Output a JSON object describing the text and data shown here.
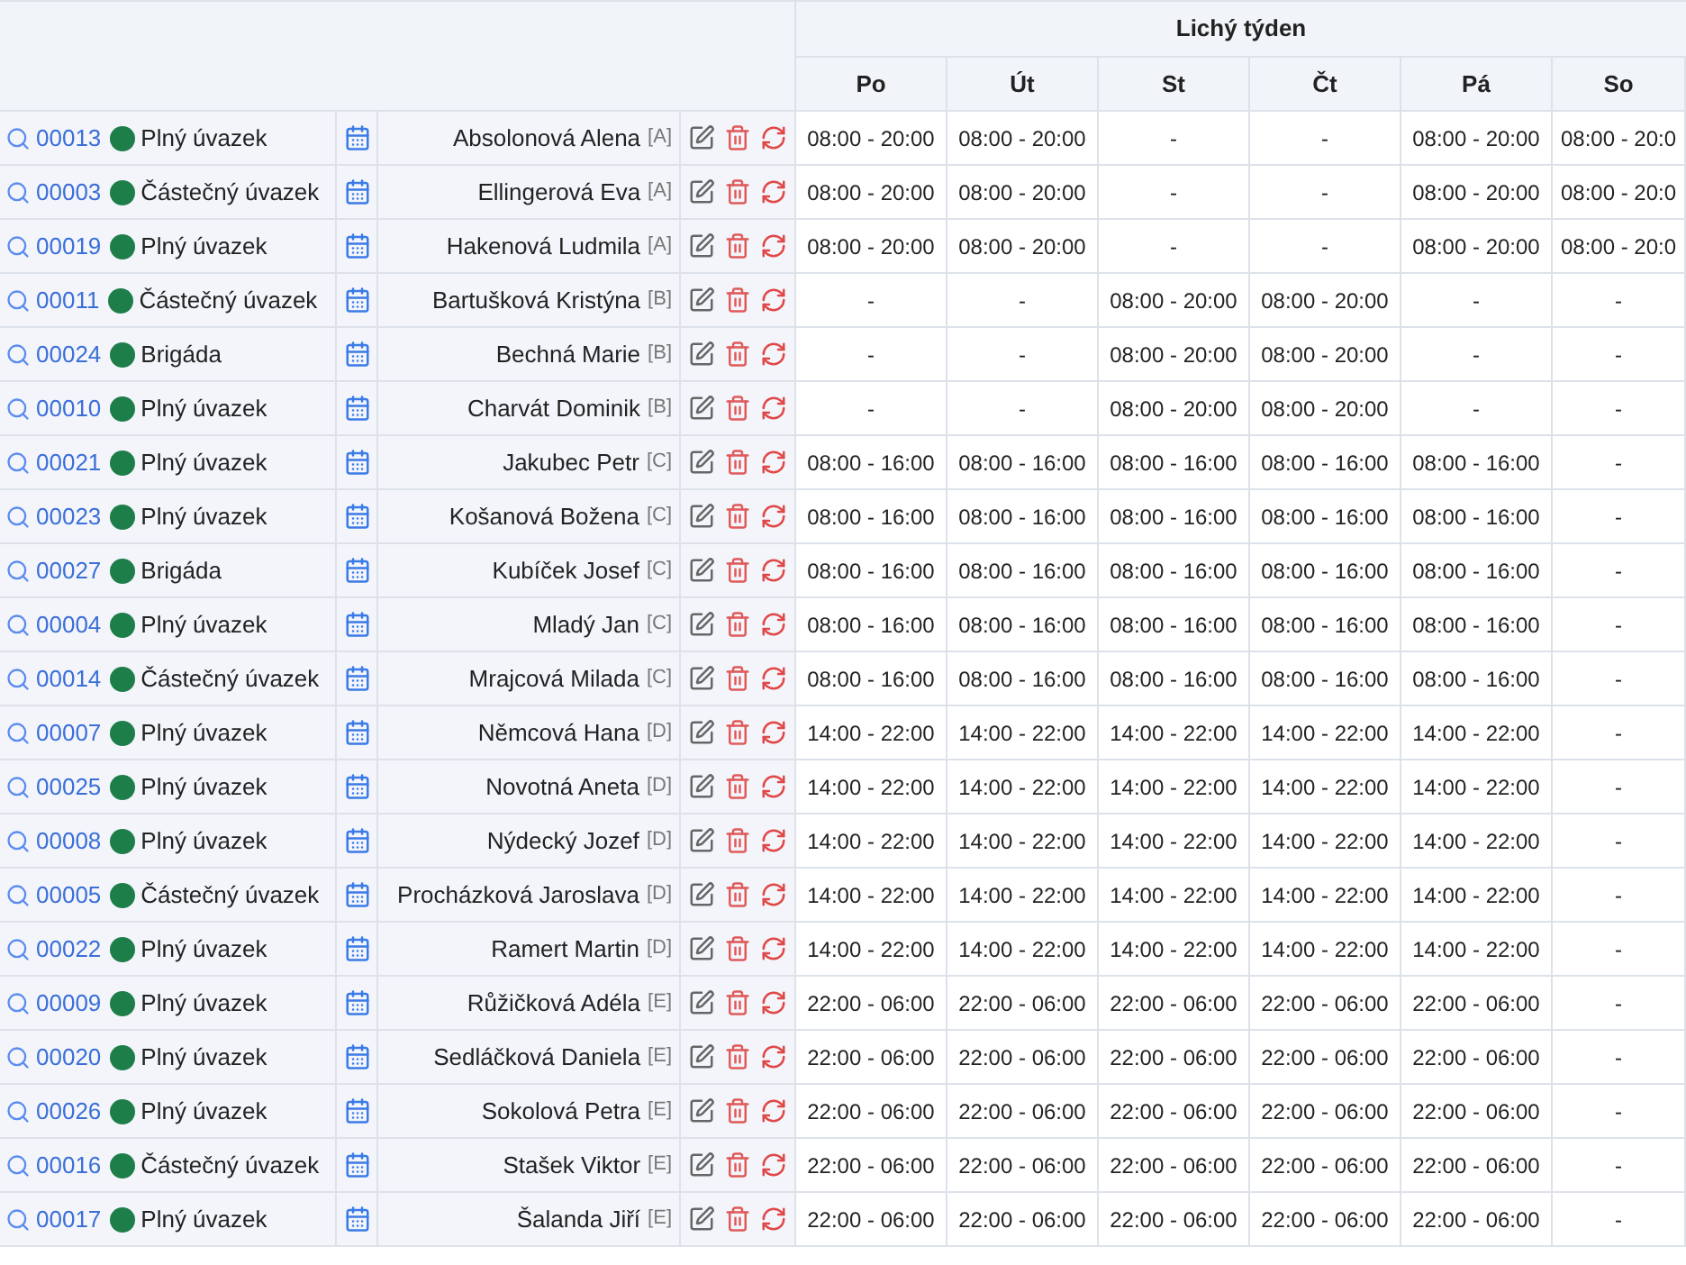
{
  "header": {
    "week_title": "Lichý týden",
    "days": [
      "Po",
      "Út",
      "St",
      "Čt",
      "Pá",
      "So"
    ]
  },
  "rows": [
    {
      "id": "00013",
      "color": "#1e7e4a",
      "type": "Plný úvazek",
      "name": "Absolonová Alena",
      "group": "[A]",
      "cells": [
        "08:00 - 20:00",
        "08:00 - 20:00",
        "-",
        "-",
        "08:00 - 20:00",
        "08:00 - 20:0"
      ]
    },
    {
      "id": "00003",
      "color": "#1e7e4a",
      "type": "Částečný úvazek",
      "name": "Ellingerová Eva",
      "group": "[A]",
      "cells": [
        "08:00 - 20:00",
        "08:00 - 20:00",
        "-",
        "-",
        "08:00 - 20:00",
        "08:00 - 20:0"
      ]
    },
    {
      "id": "00019",
      "color": "#1e7e4a",
      "type": "Plný úvazek",
      "name": "Hakenová Ludmila",
      "group": "[A]",
      "cells": [
        "08:00 - 20:00",
        "08:00 - 20:00",
        "-",
        "-",
        "08:00 - 20:00",
        "08:00 - 20:0"
      ]
    },
    {
      "id": "00011",
      "color": "#1e7e4a",
      "type": "Částečný úvazek",
      "name": "Bartušková Kristýna",
      "group": "[B]",
      "cells": [
        "-",
        "-",
        "08:00 - 20:00",
        "08:00 - 20:00",
        "-",
        "-"
      ]
    },
    {
      "id": "00024",
      "color": "#1e7e4a",
      "type": "Brigáda",
      "name": "Bechná Marie",
      "group": "[B]",
      "cells": [
        "-",
        "-",
        "08:00 - 20:00",
        "08:00 - 20:00",
        "-",
        "-"
      ]
    },
    {
      "id": "00010",
      "color": "#1e7e4a",
      "type": "Plný úvazek",
      "name": "Charvát Dominik",
      "group": "[B]",
      "cells": [
        "-",
        "-",
        "08:00 - 20:00",
        "08:00 - 20:00",
        "-",
        "-"
      ]
    },
    {
      "id": "00021",
      "color": "#1e7e4a",
      "type": "Plný úvazek",
      "name": "Jakubec Petr",
      "group": "[C]",
      "cells": [
        "08:00 - 16:00",
        "08:00 - 16:00",
        "08:00 - 16:00",
        "08:00 - 16:00",
        "08:00 - 16:00",
        "-"
      ]
    },
    {
      "id": "00023",
      "color": "#1e7e4a",
      "type": "Plný úvazek",
      "name": "Košanová Božena",
      "group": "[C]",
      "cells": [
        "08:00 - 16:00",
        "08:00 - 16:00",
        "08:00 - 16:00",
        "08:00 - 16:00",
        "08:00 - 16:00",
        "-"
      ]
    },
    {
      "id": "00027",
      "color": "#1e7e4a",
      "type": "Brigáda",
      "name": "Kubíček Josef",
      "group": "[C]",
      "cells": [
        "08:00 - 16:00",
        "08:00 - 16:00",
        "08:00 - 16:00",
        "08:00 - 16:00",
        "08:00 - 16:00",
        "-"
      ]
    },
    {
      "id": "00004",
      "color": "#1e7e4a",
      "type": "Plný úvazek",
      "name": "Mladý Jan",
      "group": "[C]",
      "cells": [
        "08:00 - 16:00",
        "08:00 - 16:00",
        "08:00 - 16:00",
        "08:00 - 16:00",
        "08:00 - 16:00",
        "-"
      ]
    },
    {
      "id": "00014",
      "color": "#1e7e4a",
      "type": "Částečný úvazek",
      "name": "Mrajcová Milada",
      "group": "[C]",
      "cells": [
        "08:00 - 16:00",
        "08:00 - 16:00",
        "08:00 - 16:00",
        "08:00 - 16:00",
        "08:00 - 16:00",
        "-"
      ]
    },
    {
      "id": "00007",
      "color": "#1e7e4a",
      "type": "Plný úvazek",
      "name": "Němcová Hana",
      "group": "[D]",
      "cells": [
        "14:00 - 22:00",
        "14:00 - 22:00",
        "14:00 - 22:00",
        "14:00 - 22:00",
        "14:00 - 22:00",
        "-"
      ]
    },
    {
      "id": "00025",
      "color": "#1e7e4a",
      "type": "Plný úvazek",
      "name": "Novotná Aneta",
      "group": "[D]",
      "cells": [
        "14:00 - 22:00",
        "14:00 - 22:00",
        "14:00 - 22:00",
        "14:00 - 22:00",
        "14:00 - 22:00",
        "-"
      ]
    },
    {
      "id": "00008",
      "color": "#1e7e4a",
      "type": "Plný úvazek",
      "name": "Nýdecký Jozef",
      "group": "[D]",
      "cells": [
        "14:00 - 22:00",
        "14:00 - 22:00",
        "14:00 - 22:00",
        "14:00 - 22:00",
        "14:00 - 22:00",
        "-"
      ]
    },
    {
      "id": "00005",
      "color": "#1e7e4a",
      "type": "Částečný úvazek",
      "name": "Procházková Jaroslava",
      "group": "[D]",
      "cells": [
        "14:00 - 22:00",
        "14:00 - 22:00",
        "14:00 - 22:00",
        "14:00 - 22:00",
        "14:00 - 22:00",
        "-"
      ]
    },
    {
      "id": "00022",
      "color": "#1e7e4a",
      "type": "Plný úvazek",
      "name": "Ramert Martin",
      "group": "[D]",
      "cells": [
        "14:00 - 22:00",
        "14:00 - 22:00",
        "14:00 - 22:00",
        "14:00 - 22:00",
        "14:00 - 22:00",
        "-"
      ]
    },
    {
      "id": "00009",
      "color": "#1e7e4a",
      "type": "Plný úvazek",
      "name": "Růžičková Adéla",
      "group": "[E]",
      "cells": [
        "22:00 - 06:00",
        "22:00 - 06:00",
        "22:00 - 06:00",
        "22:00 - 06:00",
        "22:00 - 06:00",
        "-"
      ]
    },
    {
      "id": "00020",
      "color": "#1e7e4a",
      "type": "Plný úvazek",
      "name": "Sedláčková Daniela",
      "group": "[E]",
      "cells": [
        "22:00 - 06:00",
        "22:00 - 06:00",
        "22:00 - 06:00",
        "22:00 - 06:00",
        "22:00 - 06:00",
        "-"
      ]
    },
    {
      "id": "00026",
      "color": "#1e7e4a",
      "type": "Plný úvazek",
      "name": "Sokolová Petra",
      "group": "[E]",
      "cells": [
        "22:00 - 06:00",
        "22:00 - 06:00",
        "22:00 - 06:00",
        "22:00 - 06:00",
        "22:00 - 06:00",
        "-"
      ]
    },
    {
      "id": "00016",
      "color": "#1e7e4a",
      "type": "Částečný úvazek",
      "name": "Stašek Viktor",
      "group": "[E]",
      "cells": [
        "22:00 - 06:00",
        "22:00 - 06:00",
        "22:00 - 06:00",
        "22:00 - 06:00",
        "22:00 - 06:00",
        "-"
      ]
    },
    {
      "id": "00017",
      "color": "#1e7e4a",
      "type": "Plný úvazek",
      "name": "Šalanda Jiří",
      "group": "[E]",
      "cells": [
        "22:00 - 06:00",
        "22:00 - 06:00",
        "22:00 - 06:00",
        "22:00 - 06:00",
        "22:00 - 06:00",
        "-"
      ]
    }
  ]
}
